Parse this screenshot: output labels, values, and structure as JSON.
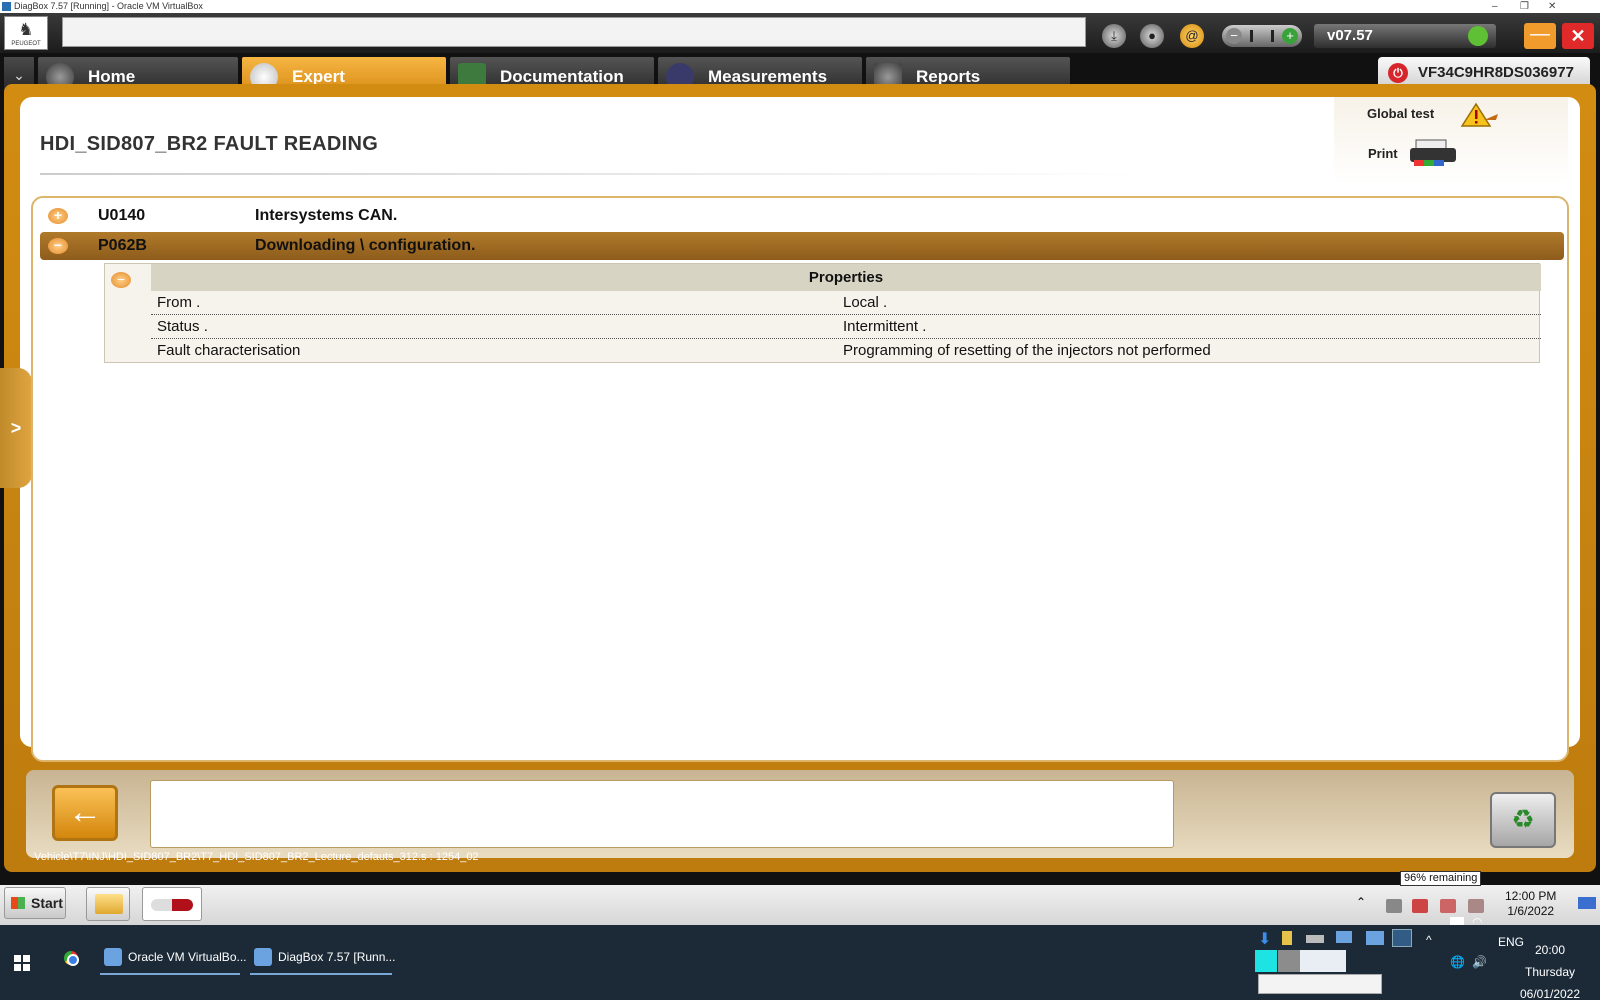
{
  "vm": {
    "title": "DiagBox 7.57 [Running] - Oracle VM VirtualBox",
    "min": "–",
    "restore": "❐",
    "close": "✕"
  },
  "toolbar": {
    "logo_text": "PEUGEOT",
    "version": "v07.57",
    "vol_minus": "−",
    "vol_plus": "+",
    "min_label": "—",
    "close_label": "✕"
  },
  "tabs": [
    {
      "label": "Home",
      "icon": "home-icon"
    },
    {
      "label": "Expert",
      "icon": "magnifier-icon"
    },
    {
      "label": "Documentation",
      "icon": "book-icon"
    },
    {
      "label": "Measurements",
      "icon": "waveform-icon"
    },
    {
      "label": "Reports",
      "icon": "report-icon"
    }
  ],
  "active_tab": "Expert",
  "vin": "VF34C9HR8DS036977",
  "page": {
    "title": "HDI_SID807_BR2  FAULT READING"
  },
  "actions": {
    "global_test": "Global test",
    "print": "Print"
  },
  "faults": [
    {
      "code": "U0140",
      "description": "Intersystems CAN.",
      "toggle": "+",
      "expanded": false
    },
    {
      "code": "P062B",
      "description": "Downloading \\ configuration.",
      "toggle": "−",
      "expanded": true
    }
  ],
  "properties": {
    "header": "Properties",
    "toggle": "−",
    "rows": [
      {
        "key": "From .",
        "value": "Local ."
      },
      {
        "key": "Status .",
        "value": "Intermittent ."
      },
      {
        "key": "Fault characterisation",
        "value": "Programming of resetting of the injectors not performed"
      }
    ]
  },
  "bottom": {
    "back": "←",
    "trash": "♻",
    "path": "Vehicle\\T7\\INJ\\HDI_SID807_BR2\\T7_HDI_SID807_BR2_Lecture_defauts_312.s : 1254_02"
  },
  "side_toggle": ">",
  "xp_taskbar": {
    "start": "Start",
    "battery_tip": "96% remaining",
    "time": "12:00 PM",
    "date": "1/6/2022",
    "tray_up": "⌃"
  },
  "win_taskbar": {
    "tasks": [
      {
        "label": "Oracle VM VirtualBo..."
      },
      {
        "label": "DiagBox 7.57 [Runn..."
      }
    ],
    "lang": "ENG",
    "time": "20:00",
    "day": "Thursday",
    "date": "06/01/2022"
  }
}
